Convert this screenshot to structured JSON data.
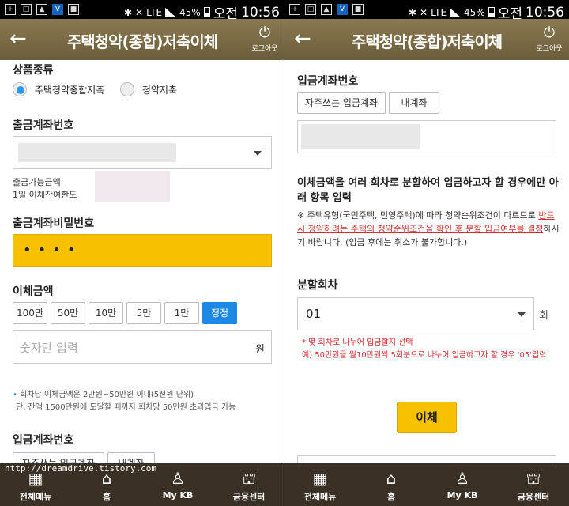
{
  "status_bar": {
    "network": "LTE",
    "battery": "45%",
    "time_prefix": "오전",
    "time": "10:56"
  },
  "header": {
    "title": "주택청약(종합)저축이체",
    "back_icon": "back-arrow-icon",
    "logout_label": "로그아웃"
  },
  "left": {
    "product_type_label": "상품종류",
    "product_options": [
      {
        "label": "주택청약종합저축",
        "selected": true
      },
      {
        "label": "청약저축",
        "selected": false
      }
    ],
    "withdraw_account_label": "출금계좌번호",
    "available_amount_label": "출금가능금액",
    "daily_remaining_label": "1일 이체잔여한도",
    "withdraw_password_label": "출금계좌비밀번호",
    "password_mask": "••••",
    "amount_label": "이체금액",
    "amount_chips": [
      "100만",
      "50만",
      "10만",
      "5만",
      "1만",
      "정정"
    ],
    "amount_placeholder": "숫자만 입력",
    "amount_unit": "원",
    "amount_note_line1": "회차당 이체금액은 2만원~50만원 이내(5천원 단위)",
    "amount_note_line2": "단, 잔액 1500만원에 도달할 때까지 회차당 50만원 초과입금 가능",
    "deposit_account_label": "입금계좌번호",
    "deposit_chips": [
      "자주쓰는 입금계좌",
      "내계좌"
    ]
  },
  "right": {
    "deposit_account_label": "입금계좌번호",
    "deposit_chips": [
      "자주쓰는 입금계좌",
      "내계좌"
    ],
    "split_intro": "이체금액을 여러 회차로 분할하여 입금하고자 할 경우에만 아래 항목 입력",
    "warn_part1": "※ 주택유형(국민주택, 민영주택)에 따라 청약순위조건이 다르므로 ",
    "warn_red": "반드시 청약하려는 주택의 청약순위조건을 확인 후 분할 입금여부를 결정",
    "warn_part2": "하시기 바랍니다. (입금 후에는 취소가 불가합니다.)",
    "split_count_label": "분할회차",
    "split_count_value": "01",
    "split_count_unit": "회",
    "split_note1": "* 몇 회차로 나누어 입금할지 선택",
    "split_note2": "예) 50만원을 월10만원씩 5회분으로 나누어 입금하고자 할 경우 '05'입력",
    "transfer_button": "이체"
  },
  "bottom_nav": [
    {
      "label": "전체메뉴",
      "icon": "grid-menu-icon"
    },
    {
      "label": "홈",
      "icon": "home-icon"
    },
    {
      "label": "My KB",
      "icon": "person-icon"
    },
    {
      "label": "금융센터",
      "icon": "bank-center-icon"
    }
  ],
  "watermark": "http://dreamdrive.tistory.com",
  "colors": {
    "header": "#7a6a45",
    "accent_yellow": "#f6c200",
    "accent_blue": "#1e88e5",
    "nav_bg": "#3b3025",
    "warning_red": "#d32f2f"
  }
}
